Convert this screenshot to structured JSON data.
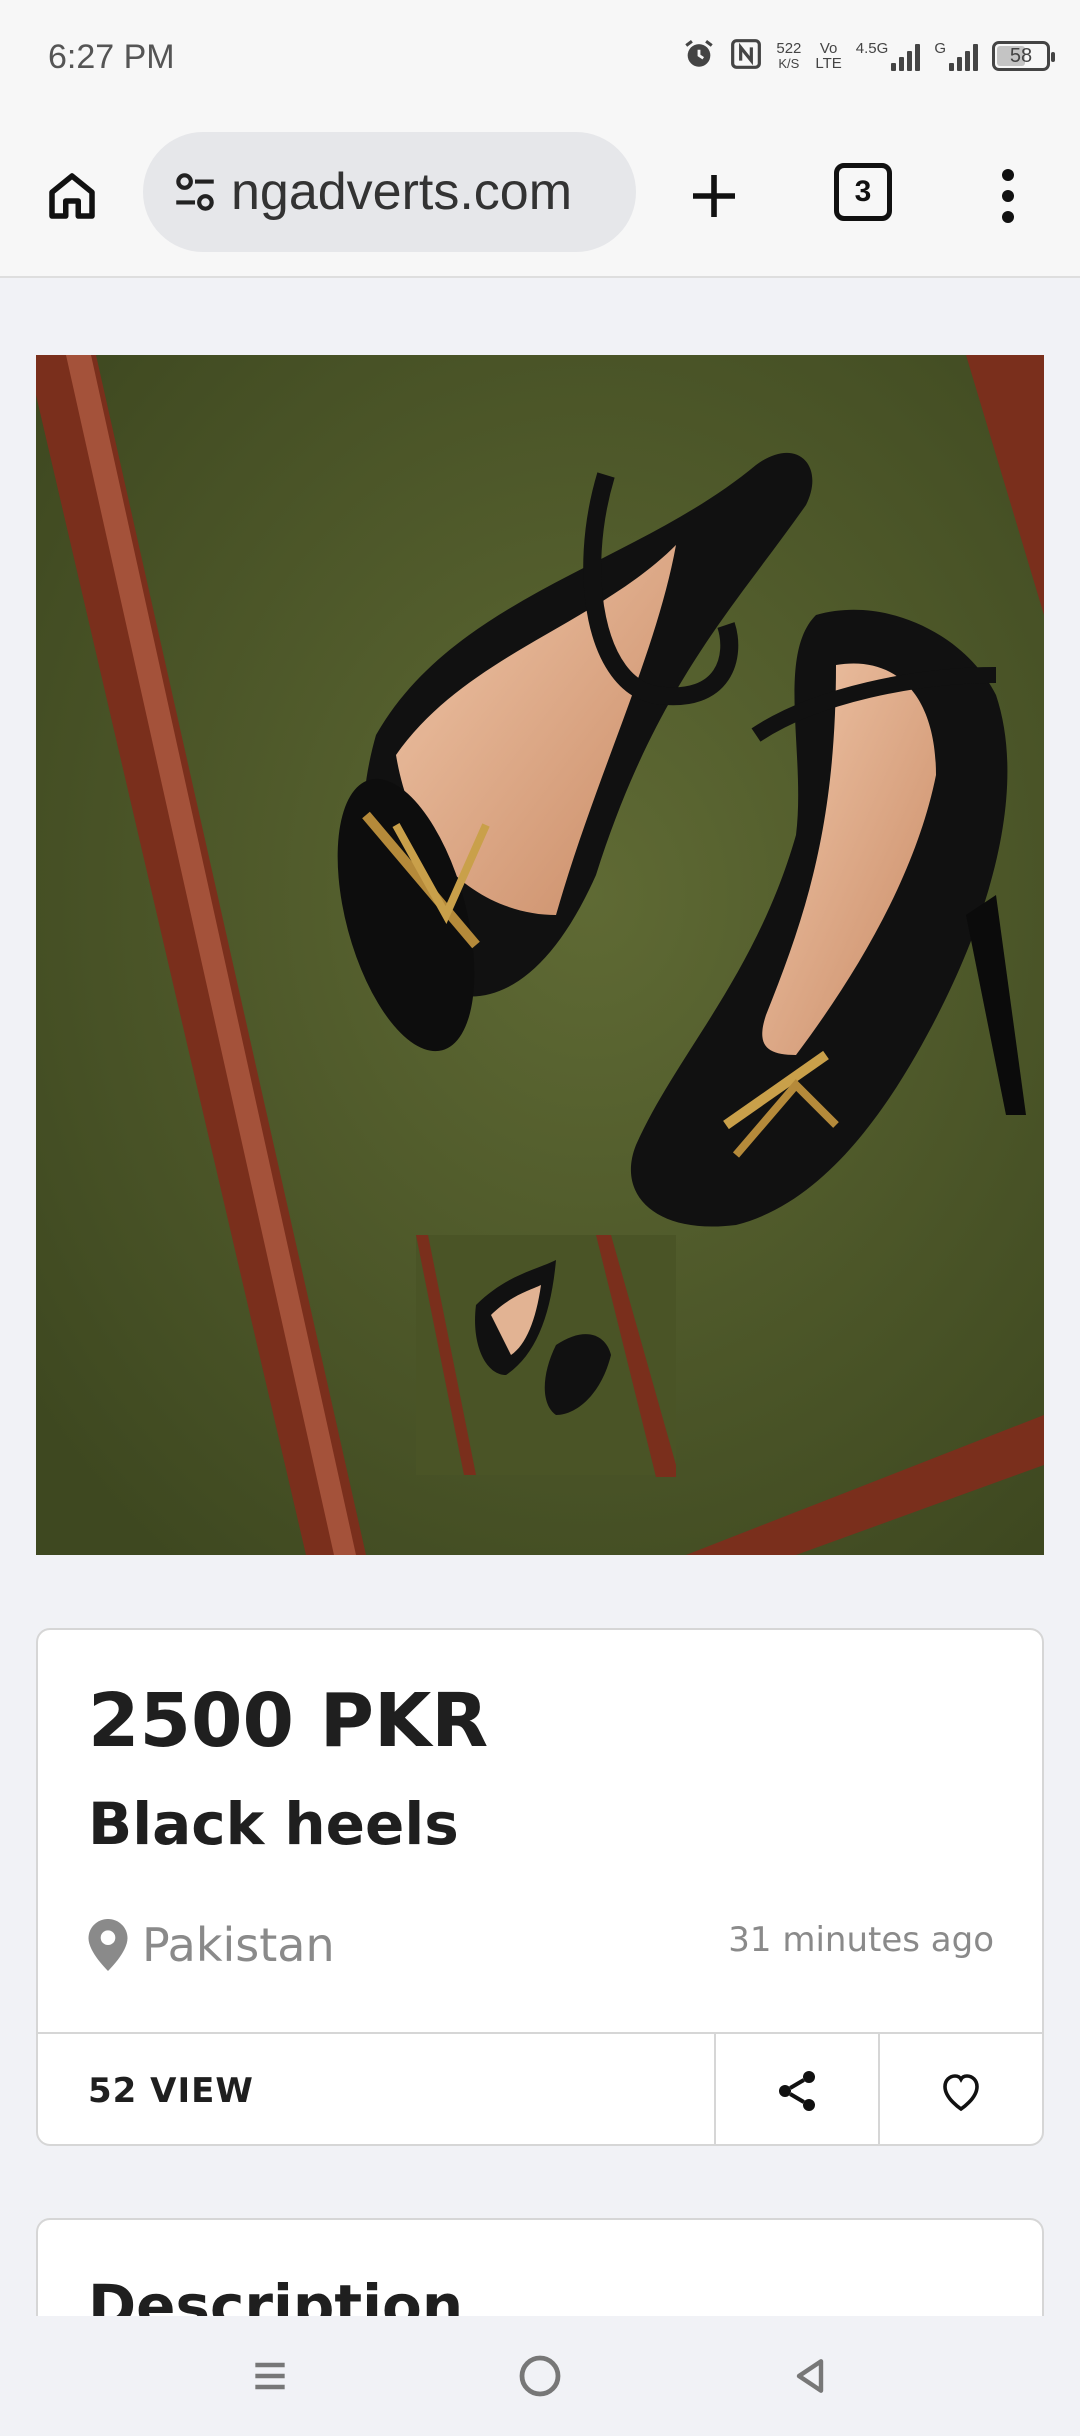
{
  "status_bar": {
    "time": "6:27 PM",
    "net_speed_value": "522",
    "net_speed_unit": "K/S",
    "volte_top": "Vo",
    "volte_bottom": "LTE",
    "signal1_label": "4.5G",
    "signal2_label": "G",
    "battery": "58",
    "battery_level": 0.58
  },
  "browser": {
    "url": "ngadverts.com",
    "tab_count": "3"
  },
  "listing": {
    "price": "2500 PKR",
    "title": "Black heels",
    "location": "Pakistan",
    "posted": "31 minutes ago",
    "views": "52 VIEW"
  },
  "description": {
    "heading": "Description"
  },
  "icons": {
    "home": "home-icon",
    "site_settings": "tune-icon",
    "new_tab": "plus-icon",
    "menu": "more-vert-icon",
    "location": "location-pin-icon",
    "share": "share-icon",
    "favorite": "heart-icon"
  },
  "colors": {
    "page_bg": "#f1f2f6",
    "card_bg": "#ffffff",
    "text_primary": "#1f1f1f",
    "text_muted": "#8a8a8a",
    "image_bg": "#4e5a2a"
  }
}
